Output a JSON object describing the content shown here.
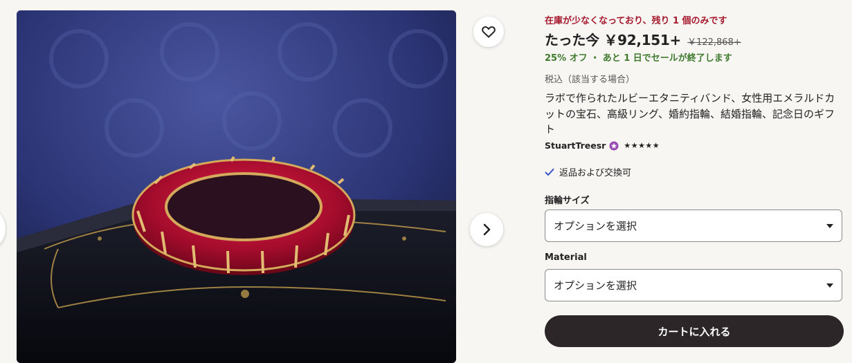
{
  "listing": {
    "image_alt": "ring-photo",
    "stock_notice": "在庫が少なくなっており、残り 1 個のみです",
    "price_label": "たった今 ￥92,151+",
    "price_original": "￥122,868+",
    "sale_info": "25% オフ ・ あと 1 日でセールが終了します",
    "tax_note": "税込（該当する場合）",
    "title": "ラボで作られたルビーエタニティバンド、女性用エメラルドカットの宝石、高級リング、婚約指輪、結婚指輪、記念日のギフト",
    "seller": "StuartTreesr",
    "rating_stars": "★★★★★",
    "returns": "返品および交換可"
  },
  "options": {
    "ring_size_label": "指輪サイズ",
    "ring_size_value": "オプションを選択",
    "material_label": "Material",
    "material_value": "オプションを選択"
  },
  "actions": {
    "add_to_cart": "カートに入れる"
  },
  "colors": {
    "stock": "#a61a2e",
    "sale": "#3e7a2d",
    "cart_button": "#2c2628",
    "star_seller_badge": "#9b4db6"
  },
  "icons": [
    "heart-icon",
    "chevron-right-icon",
    "chevron-left-icon",
    "check-icon",
    "star-seller-badge-icon",
    "caret-down-icon"
  ]
}
